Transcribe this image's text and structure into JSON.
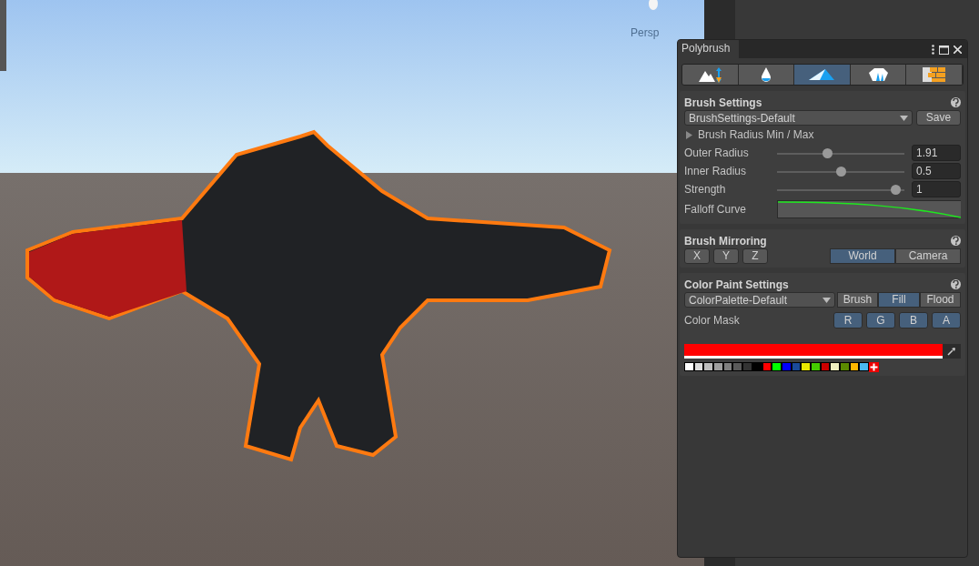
{
  "viewport": {
    "camera_label": "Persp"
  },
  "window": {
    "title": "Polybrush"
  },
  "tabs": [
    {
      "kind": "sculpt",
      "selected": false
    },
    {
      "kind": "smooth",
      "selected": false
    },
    {
      "kind": "paint",
      "selected": true
    },
    {
      "kind": "prefab",
      "selected": false
    },
    {
      "kind": "texture",
      "selected": false
    }
  ],
  "brush_settings": {
    "title": "Brush Settings",
    "preset": "BrushSettings-Default",
    "save": "Save",
    "foldout": {
      "label": "Brush Radius Min / Max",
      "expanded": false
    },
    "sliders": [
      {
        "label": "Outer Radius",
        "level": 0.39,
        "reading": "1.91"
      },
      {
        "label": "Inner Radius",
        "level": 0.5,
        "reading": "0.5"
      },
      {
        "label": "Strength",
        "level": 0.97,
        "reading": "1"
      }
    ],
    "falloff_label": "Falloff Curve"
  },
  "mirroring": {
    "title": "Brush Mirroring",
    "axes": [
      {
        "label": "X",
        "selected": false
      },
      {
        "label": "Y",
        "selected": false
      },
      {
        "label": "Z",
        "selected": false
      }
    ],
    "spaces": [
      {
        "label": "World",
        "selected": true
      },
      {
        "label": "Camera",
        "selected": false
      }
    ]
  },
  "color_paint": {
    "title": "Color Paint Settings",
    "palette": "ColorPalette-Default",
    "modes": [
      {
        "label": "Brush",
        "selected": false
      },
      {
        "label": "Fill",
        "selected": true
      },
      {
        "label": "Flood",
        "selected": false
      }
    ],
    "mask_label": "Color Mask",
    "channels": [
      {
        "label": "R",
        "selected": true
      },
      {
        "label": "G",
        "selected": true
      },
      {
        "label": "B",
        "selected": true
      },
      {
        "label": "A",
        "selected": true
      }
    ],
    "color_field": {
      "color": "#ff0000"
    },
    "swatches": [
      {
        "color": "#ffffff"
      },
      {
        "color": "#dcdcdc"
      },
      {
        "color": "#bcbcbc"
      },
      {
        "color": "#9e9e9e"
      },
      {
        "color": "#7f7f7f"
      },
      {
        "color": "#5a5a5a"
      },
      {
        "color": "#333333"
      },
      {
        "color": "#000000"
      },
      {
        "color": "#ff0000"
      },
      {
        "color": "#00ff00"
      },
      {
        "color": "#0000ff"
      },
      {
        "color": "#1a4a9a"
      },
      {
        "color": "#e8e800"
      },
      {
        "color": "#44cc00"
      },
      {
        "color": "#cc0000"
      },
      {
        "color": "#efefc0"
      },
      {
        "color": "#5a8a00"
      },
      {
        "color": "#ffb800"
      },
      {
        "color": "#4ab8f0"
      }
    ]
  }
}
